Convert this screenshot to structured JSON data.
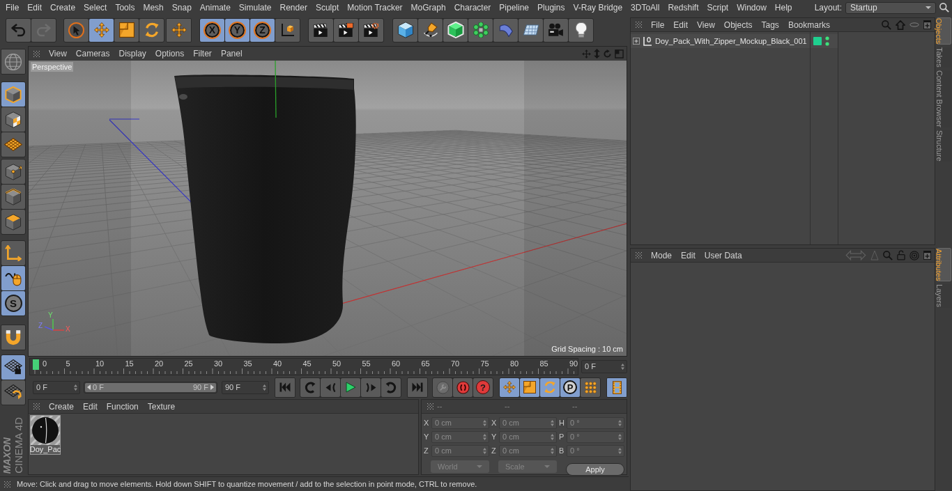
{
  "menu_bar": {
    "items": [
      "File",
      "Edit",
      "Create",
      "Select",
      "Tools",
      "Mesh",
      "Snap",
      "Animate",
      "Simulate",
      "Render",
      "Sculpt",
      "Motion Tracker",
      "MoGraph",
      "Character",
      "Pipeline",
      "Plugins",
      "V-Ray Bridge",
      "3DToAll",
      "Redshift",
      "Script",
      "Window",
      "Help"
    ],
    "layout": {
      "label": "Layout:",
      "value": "Startup"
    }
  },
  "toolbar": {
    "groups": [
      [
        {
          "selected": false,
          "disabled": false
        },
        {
          "selected": false,
          "disabled": true
        }
      ],
      [
        {
          "selected": false
        },
        {
          "selected": true
        },
        {
          "selected": false
        },
        {
          "selected": false
        }
      ],
      [
        {
          "selected": false
        }
      ],
      [
        {
          "label": "X",
          "selected": true
        },
        {
          "label": "Y",
          "selected": true
        },
        {
          "label": "Z",
          "selected": true
        },
        {
          "selected": false
        }
      ],
      [
        {
          "selected": false
        },
        {
          "selected": false
        },
        {
          "selected": false
        }
      ],
      [
        {
          "selected": false
        },
        {
          "selected": false
        },
        {
          "selected": false
        },
        {
          "selected": false
        },
        {
          "selected": false
        },
        {
          "selected": false
        },
        {
          "selected": false
        },
        {
          "selected": false
        }
      ]
    ]
  },
  "left_toolbar": {
    "groups": [
      [
        {
          "selected": false
        }
      ],
      [
        {
          "selected": true
        },
        {
          "selected": false
        },
        {
          "selected": false
        }
      ],
      [
        {
          "selected": false
        },
        {
          "selected": false
        },
        {
          "selected": false
        }
      ],
      [
        {
          "selected": false
        },
        {
          "selected": true
        },
        {
          "label": "S",
          "selected": true
        }
      ],
      [
        {
          "selected": false
        }
      ],
      [
        {
          "selected": true
        },
        {
          "selected": false
        }
      ]
    ],
    "logo": {
      "brand": "MAXON",
      "product": "CINEMA 4D"
    }
  },
  "viewport": {
    "menu": [
      "View",
      "Cameras",
      "Display",
      "Options",
      "Filter",
      "Panel"
    ],
    "camera": "Perspective",
    "grid_spacing": "Grid Spacing : 10 cm",
    "axis_labels": [
      "Y",
      "Z",
      "X"
    ]
  },
  "timeline": {
    "ticks": [
      "0",
      "5",
      "10",
      "15",
      "20",
      "25",
      "30",
      "35",
      "40",
      "45",
      "50",
      "55",
      "60",
      "65",
      "70",
      "75",
      "80",
      "85",
      "90"
    ],
    "playhead": {
      "level": 0
    },
    "current_frame": "0 F",
    "start_frame": "0 F",
    "range": {
      "start": "0 F",
      "end": "90 F",
      "level": 1
    },
    "end_frame": "90 F",
    "record_buttons": [
      {
        "disabled": true
      },
      {
        "disabled": false
      },
      {
        "label": "?",
        "disabled": false
      }
    ],
    "key_buttons": [
      {
        "selected": true
      },
      {
        "selected": true
      },
      {
        "selected": true
      },
      {
        "label": "P",
        "selected": true
      },
      {
        "selected": false
      }
    ],
    "timeline_button": {
      "selected": true
    }
  },
  "material_manager": {
    "menu": [
      "Create",
      "Edit",
      "Function",
      "Texture"
    ],
    "materials": [
      {
        "name": "Doy_Pac"
      }
    ]
  },
  "coordinates": {
    "headers": [
      "--",
      "--",
      "--"
    ],
    "rows": [
      {
        "position_axis": "X",
        "position": "0 cm",
        "size_axis": "X",
        "size": "0 cm",
        "rotation_axis": "H",
        "rotation": "0 °"
      },
      {
        "position_axis": "Y",
        "position": "0 cm",
        "size_axis": "Y",
        "size": "0 cm",
        "rotation_axis": "P",
        "rotation": "0 °"
      },
      {
        "position_axis": "Z",
        "position": "0 cm",
        "size_axis": "Z",
        "size": "0 cm",
        "rotation_axis": "B",
        "rotation": "0 °"
      }
    ],
    "dropdowns": [
      {
        "value": "World",
        "disabled": true
      },
      {
        "value": "Scale",
        "disabled": true
      }
    ],
    "apply": "Apply"
  },
  "status_bar": "Move: Click and drag to move elements. Hold down SHIFT to quantize movement / add to the selection in point mode, CTRL to remove.",
  "object_manager": {
    "menu": [
      "File",
      "Edit",
      "View",
      "Objects",
      "Tags",
      "Bookmarks"
    ],
    "objects": [
      {
        "name": "Doy_Pack_With_Zipper_Mockup_Black_001",
        "expanded": false,
        "color": "#1fd08f"
      }
    ]
  },
  "attribute_manager": {
    "menu": [
      "Mode",
      "Edit",
      "User Data"
    ]
  },
  "side_tabs": {
    "top": [
      {
        "label": "Objects",
        "selected": true
      },
      {
        "label": "Takes",
        "selected": false
      },
      {
        "label": "Content Browser",
        "selected": false
      },
      {
        "label": "Structure",
        "selected": false
      }
    ],
    "bottom": [
      {
        "label": "Attributes",
        "selected": true
      },
      {
        "label": "Layers",
        "selected": false
      }
    ]
  }
}
